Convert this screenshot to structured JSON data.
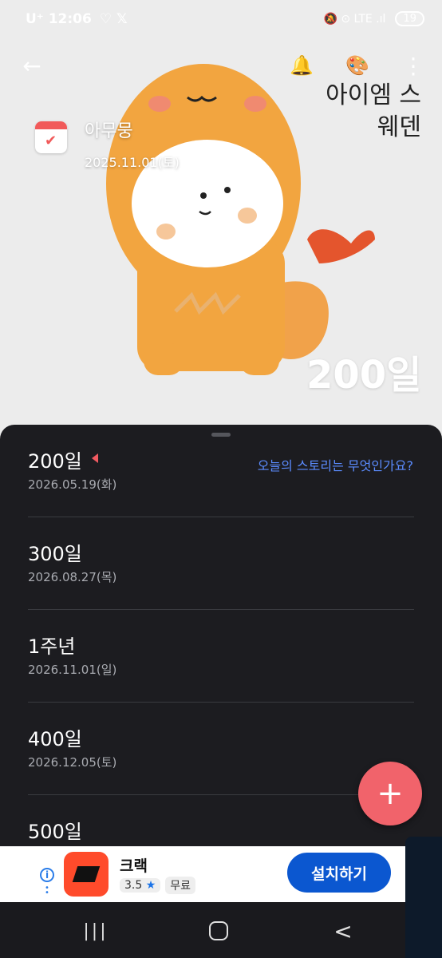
{
  "status_bar": {
    "carrier_time": "U⁺ 12:06",
    "extra_icons": "♡ 𝕏",
    "right_icons": "🔕 ⊙ LTE .ıl",
    "battery": "19"
  },
  "toolbar": {
    "back_icon": "←",
    "alarm_icon": "🔔",
    "theme_icon": "🎨",
    "more_icon": "⋮"
  },
  "header": {
    "title": "아무뭉",
    "date": "2025.11.01(토)",
    "big_days": "200일",
    "handwriting": "아이엠 스웨덴"
  },
  "sheet": {
    "story_link": "오늘의 스토리는 무엇인가요?",
    "milestones": [
      {
        "title": "200일",
        "date": "2026.05.19(화)",
        "current": true
      },
      {
        "title": "300일",
        "date": "2026.08.27(목)"
      },
      {
        "title": "1주년",
        "date": "2026.11.01(일)"
      },
      {
        "title": "400일",
        "date": "2026.12.05(토)"
      },
      {
        "title": "500일",
        "date": ""
      }
    ]
  },
  "fab": {
    "label": "+"
  },
  "ad": {
    "info_icon": "i",
    "app_name": "크랙",
    "rating": "3.5",
    "star": "★",
    "price": "무료",
    "install": "설치하기"
  },
  "navbar": {
    "recent": "|||",
    "back": "<"
  },
  "colors": {
    "accent": "#f1636b",
    "link": "#5b8cff",
    "sheet_bg": "#1c1c20",
    "install_btn": "#0b57d0"
  }
}
